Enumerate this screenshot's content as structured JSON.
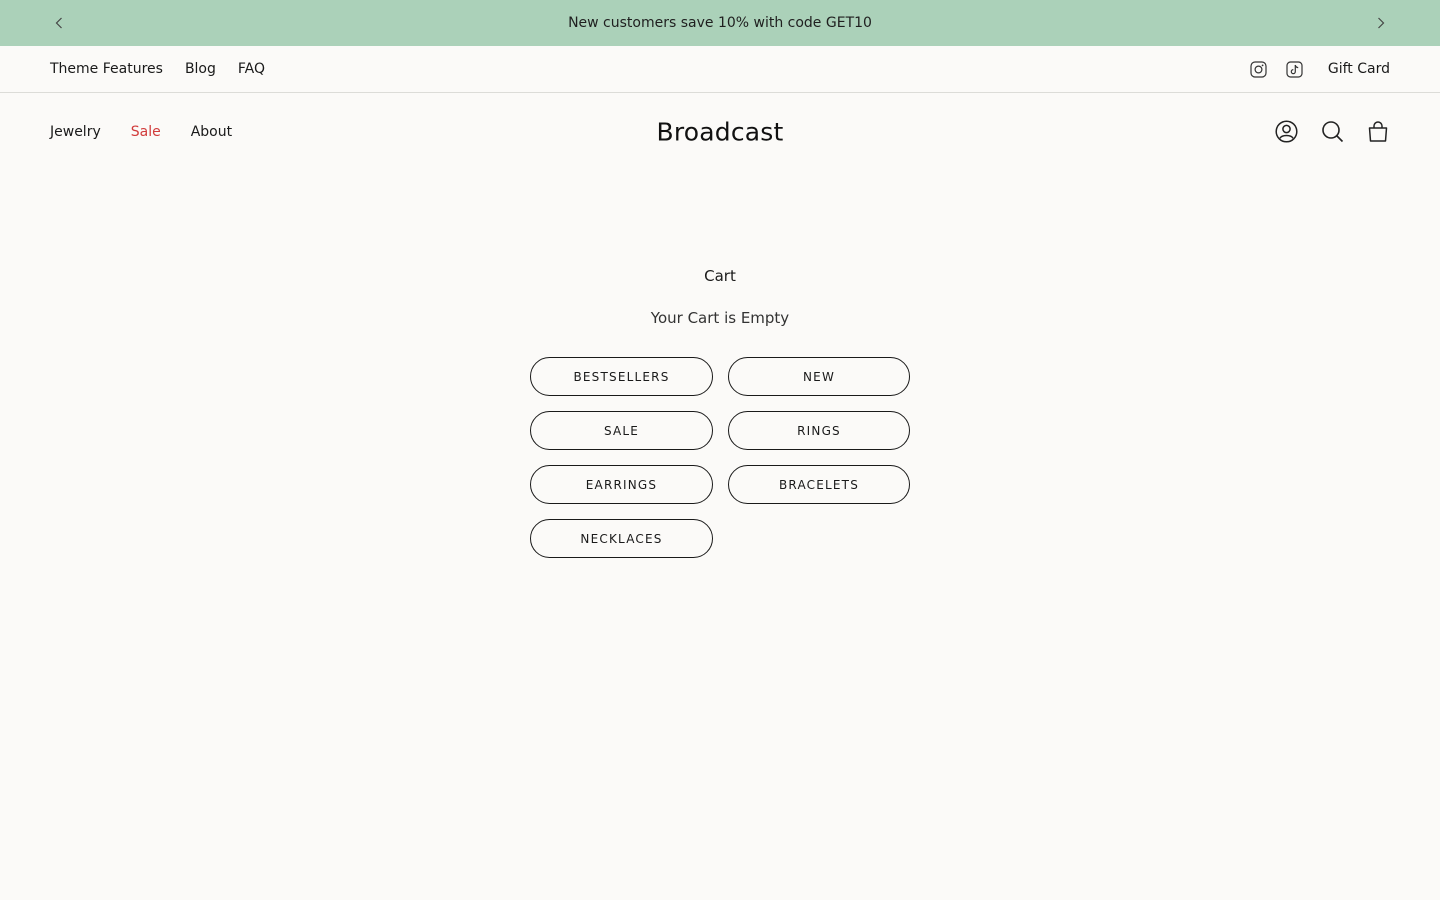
{
  "announcement": {
    "message": "New customers save 10% with code GET10",
    "background": "#abd1b9"
  },
  "utility_nav": {
    "links": [
      "Theme Features",
      "Blog",
      "FAQ"
    ],
    "social_icons": [
      "instagram-icon",
      "tiktok-icon"
    ],
    "gift_card": "Gift Card"
  },
  "header": {
    "logo": "Broadcast",
    "nav": [
      "Jewelry",
      "Sale",
      "About"
    ],
    "sale_color": "#d13b3b",
    "icons": [
      "account-icon",
      "search-icon",
      "cart-icon"
    ]
  },
  "cart": {
    "title": "Cart",
    "empty_message": "Your Cart is Empty",
    "collections": [
      "BESTSELLERS",
      "NEW",
      "SALE",
      "RINGS",
      "EARRINGS",
      "BRACELETS",
      "NECKLACES"
    ]
  }
}
